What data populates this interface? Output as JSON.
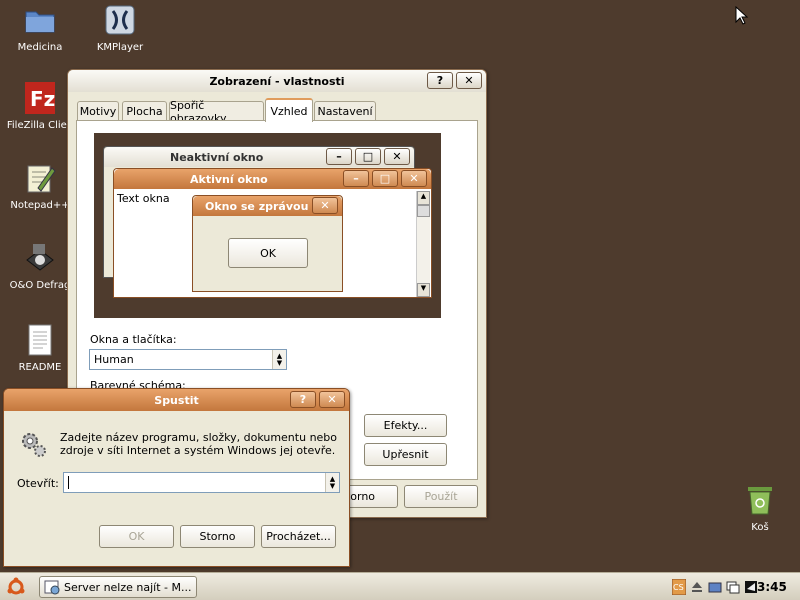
{
  "desktop": {
    "icons": [
      {
        "label": "Medicina",
        "icon": "folder-icon"
      },
      {
        "label": "KMPlayer",
        "icon": "kmplayer-icon"
      },
      {
        "label": "FileZilla Clien",
        "icon": "filezilla-icon"
      },
      {
        "label": "Notepad++",
        "icon": "notepad-icon"
      },
      {
        "label": "O&O Defrag",
        "icon": "defrag-icon"
      },
      {
        "label": "README",
        "icon": "document-icon"
      },
      {
        "label": "Koš",
        "icon": "recycle-bin-icon"
      }
    ]
  },
  "display_props": {
    "title": "Zobrazení - vlastnosti",
    "tabs": [
      "Motivy",
      "Plocha",
      "Spořič obrazovky",
      "Vzhled",
      "Nastavení"
    ],
    "active_tab": "Vzhled",
    "preview": {
      "inactive_title": "Neaktivní okno",
      "active_title": "Aktivní okno",
      "text": "Text okna",
      "msgbox_title": "Okno se zprávou",
      "ok": "OK"
    },
    "windows_buttons_label": "Okna a tlačítka:",
    "windows_buttons_value": "Human",
    "color_scheme_label": "Barevné schéma:",
    "effects_button": "Efekty...",
    "advanced_button": "Upřesnit",
    "cancel_button": "Storno",
    "apply_button": "Použít"
  },
  "run_dialog": {
    "title": "Spustit",
    "description_line1": "Zadejte název programu, složky, dokumentu nebo",
    "description_line2": "zdroje v síti Internet a systém Windows jej otevře.",
    "open_label": "Otevřít:",
    "open_value": "",
    "ok": "OK",
    "cancel": "Storno",
    "browse": "Procházet..."
  },
  "taskbar": {
    "task_label": "Server nelze najít - M...",
    "clock": "3:45"
  },
  "colors": {
    "desktop": "#4e3b2d",
    "accent": "#c3773d"
  }
}
